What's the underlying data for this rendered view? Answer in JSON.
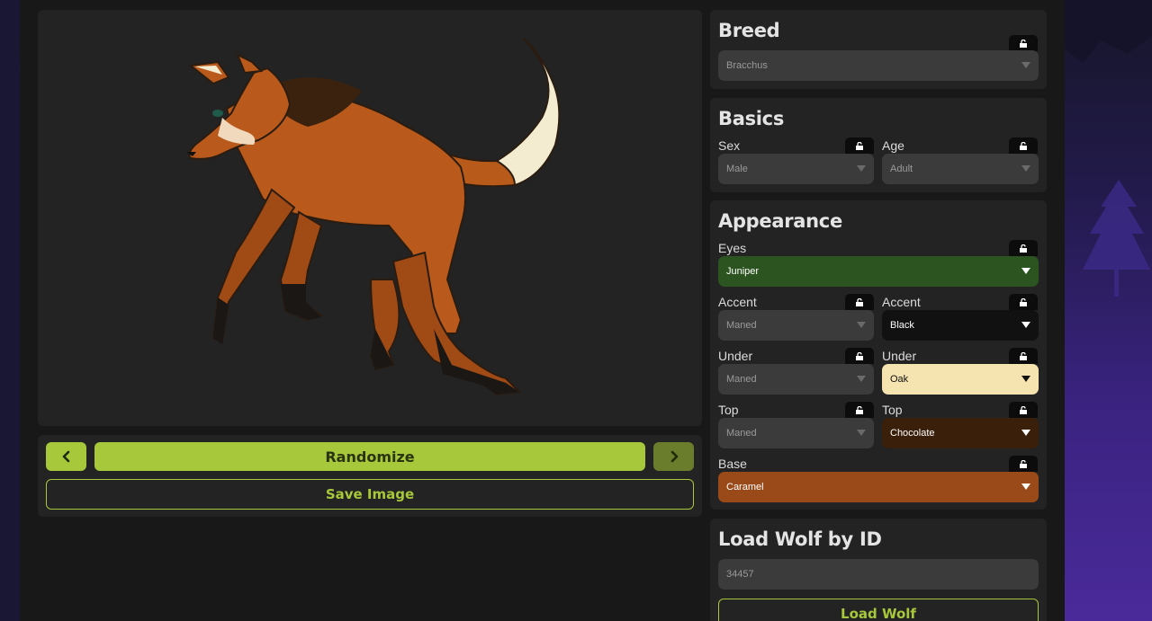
{
  "controls": {
    "randomize_label": "Randomize",
    "save_image_label": "Save Image"
  },
  "breed": {
    "title": "Breed",
    "value": "Bracchus"
  },
  "basics": {
    "title": "Basics",
    "sex_label": "Sex",
    "sex_value": "Male",
    "age_label": "Age",
    "age_value": "Adult"
  },
  "appearance": {
    "title": "Appearance",
    "eyes_label": "Eyes",
    "eyes_value": "Juniper",
    "accent_label": "Accent",
    "accent_pattern": "Maned",
    "accent_color": "Black",
    "under_label": "Under",
    "under_pattern": "Maned",
    "under_color": "Oak",
    "top_label": "Top",
    "top_pattern": "Maned",
    "top_color": "Chocolate",
    "base_label": "Base",
    "base_color": "Caramel"
  },
  "colors": {
    "accent_green": "#a6c83a",
    "juniper": "#2c5420",
    "black": "#111111",
    "oak": "#f5e3b0",
    "chocolate": "#3a1f0a",
    "caramel": "#9a4a18"
  },
  "load": {
    "title": "Load Wolf by ID",
    "placeholder": "34457",
    "button_label": "Load Wolf"
  }
}
